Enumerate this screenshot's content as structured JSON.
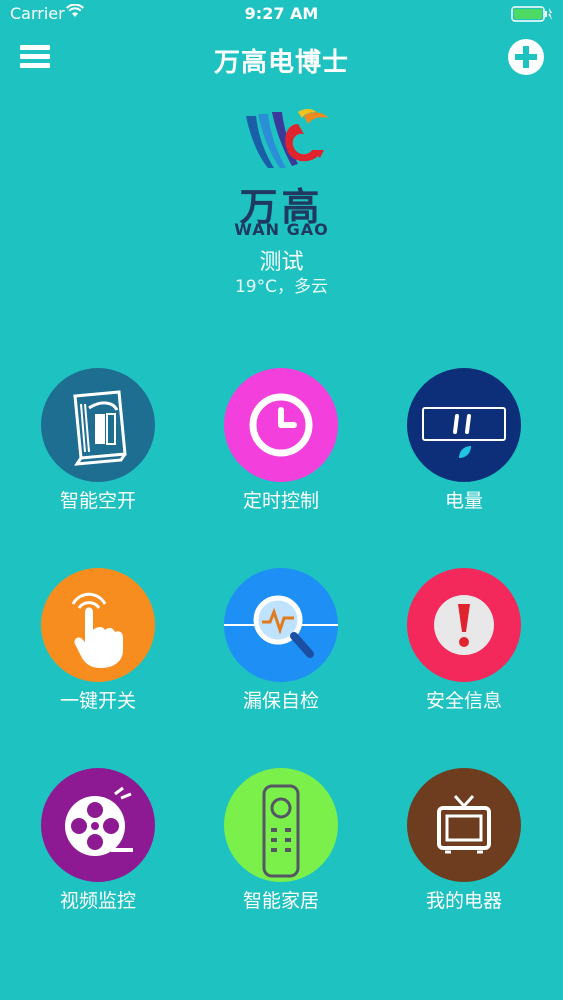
{
  "status_bar": {
    "carrier": "Carrier",
    "time": "9:27 AM"
  },
  "nav": {
    "title": "万高电博士",
    "menu_icon": "hamburger-menu-icon",
    "add_icon": "plus-circle-icon"
  },
  "brand": {
    "name_cn": "万高",
    "name_en": "WAN GAO"
  },
  "location": {
    "name": "测试",
    "weather": "19°C，多云"
  },
  "tiles": [
    {
      "label": "智能空开",
      "icon": "circuit-breaker-icon",
      "color": "#1e6e91"
    },
    {
      "label": "定时控制",
      "icon": "clock-icon",
      "color": "#f33fdc"
    },
    {
      "label": "电量",
      "icon": "energy-meter-icon",
      "color": "#0d2f7a"
    },
    {
      "label": "一键开关",
      "icon": "touch-hand-icon",
      "color": "#f78d1e"
    },
    {
      "label": "漏保自检",
      "icon": "magnifier-wave-icon",
      "color": "#1e8ff4"
    },
    {
      "label": "安全信息",
      "icon": "alert-exclamation-icon",
      "color": "#f2295a"
    },
    {
      "label": "视频监控",
      "icon": "film-reel-icon",
      "color": "#8e1a93"
    },
    {
      "label": "智能家居",
      "icon": "remote-control-icon",
      "color": "#7bf04a"
    },
    {
      "label": "我的电器",
      "icon": "tv-icon",
      "color": "#6e3d1f"
    }
  ]
}
